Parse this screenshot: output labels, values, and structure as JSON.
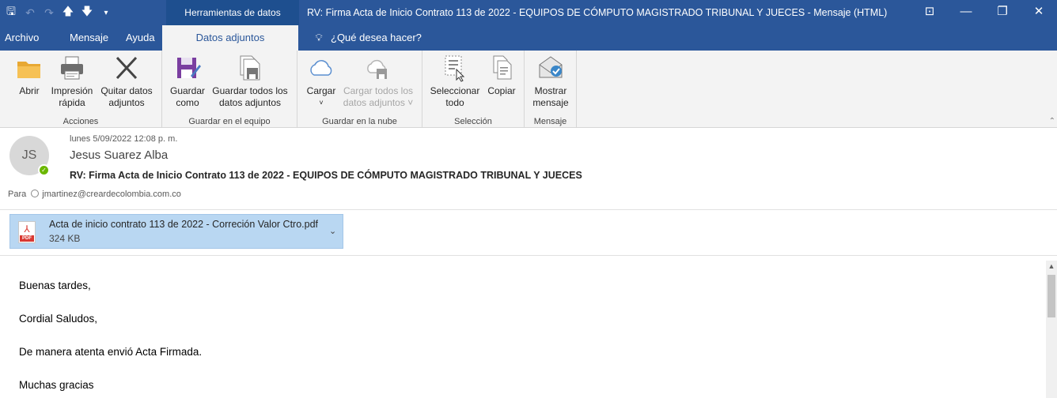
{
  "window": {
    "context_tab": "Herramientas de datos adjuntos",
    "title": "RV: Firma Acta de Inicio Contrato 113 de 2022 - EQUIPOS DE CÓMPUTO MAGISTRADO TRIBUNAL Y JUECES  -  Mensaje (HTML)"
  },
  "tabs": [
    {
      "label": "Archivo"
    },
    {
      "label": "Mensaje"
    },
    {
      "label": "Ayuda"
    },
    {
      "label": "Datos adjuntos"
    }
  ],
  "tellme": "¿Qué desea hacer?",
  "ribbon": {
    "groups": [
      {
        "label": "Acciones",
        "buttons": [
          {
            "line1": "Abrir",
            "line2": "",
            "icon": "folder-icon"
          },
          {
            "line1": "Impresión",
            "line2": "rápida",
            "icon": "printer-icon"
          },
          {
            "line1": "Quitar datos",
            "line2": "adjuntos",
            "icon": "x-icon"
          }
        ]
      },
      {
        "label": "Guardar en el equipo",
        "buttons": [
          {
            "line1": "Guardar",
            "line2": "como",
            "icon": "save-as-icon"
          },
          {
            "line1": "Guardar todos los",
            "line2": "datos adjuntos",
            "icon": "save-all-icon"
          }
        ]
      },
      {
        "label": "Guardar en la nube",
        "buttons": [
          {
            "line1": "Cargar",
            "line2": "˅",
            "icon": "cloud-icon"
          },
          {
            "line1": "Cargar todos los",
            "line2": "datos adjuntos ˅",
            "icon": "cloud-save-icon"
          }
        ]
      },
      {
        "label": "Selección",
        "buttons": [
          {
            "line1": "Seleccionar",
            "line2": "todo",
            "icon": "select-all-icon"
          },
          {
            "line1": "Copiar",
            "line2": "",
            "icon": "copy-icon"
          }
        ]
      },
      {
        "label": "Mensaje",
        "buttons": [
          {
            "line1": "Mostrar",
            "line2": "mensaje",
            "icon": "show-message-icon"
          }
        ]
      }
    ]
  },
  "header": {
    "initials": "JS",
    "date": "lunes 5/09/2022 12:08 p. m.",
    "sender": "Jesus Suarez Alba",
    "subject": "RV: Firma Acta de Inicio Contrato 113 de 2022 - EQUIPOS DE CÓMPUTO MAGISTRADO TRIBUNAL Y JUECES",
    "to_label": "Para",
    "to": "jmartinez@creardecolombia.com.co"
  },
  "attachment": {
    "name": "Acta de inicio contrato  113 de 2022 - Correción Valor Ctro.pdf",
    "size": "324 KB",
    "icon_tag": "PDF"
  },
  "body": [
    "Buenas tardes,",
    "Cordial Saludos,",
    "De manera atenta envió Acta Firmada.",
    "Muchas gracias"
  ],
  "colors": {
    "titlebar": "#2b579a",
    "attachment_selected": "#b9d7f2",
    "presence": "#6bb700",
    "pdf": "#d93831"
  }
}
